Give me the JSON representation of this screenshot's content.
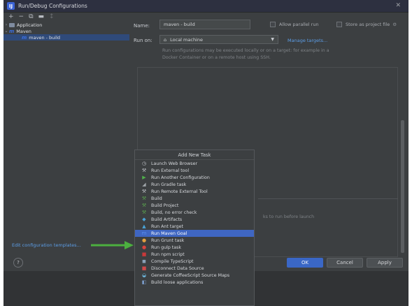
{
  "window": {
    "title": "Run/Debug Configurations",
    "close": "✕"
  },
  "toolbar": {
    "add": "+",
    "remove": "−",
    "copy": "⧉",
    "folder": "▬",
    "sort": "↕"
  },
  "tree": {
    "application": "Application",
    "maven": "Maven",
    "maven_build": "maven - build"
  },
  "form": {
    "name_label": "Name:",
    "name_value": "maven - build",
    "allow_parallel": "Allow parallel run",
    "store_as_project": "Store as project file",
    "run_on_label": "Run on:",
    "run_on_value": "Local machine",
    "manage_targets": "Manage targets...",
    "description": "Run configurations may be executed locally or on a target: for example in a Docker Container or on a remote host using SSH.",
    "before_launch_hint": "ks to run before launch"
  },
  "left": {
    "edit_templates": "Edit configuration templates...",
    "help": "?"
  },
  "buttons": {
    "ok": "OK",
    "cancel": "Cancel",
    "apply": "Apply"
  },
  "popup": {
    "header": "Add New Task",
    "items": [
      {
        "label": "Launch Web Browser",
        "icon": "globe-icon",
        "glyph": "◷",
        "color": "#bfc3c8"
      },
      {
        "label": "Run External tool",
        "icon": "wrench-icon",
        "glyph": "⚒",
        "color": "#bfc3c8"
      },
      {
        "label": "Run Another Configuration",
        "icon": "play-icon",
        "glyph": "▶",
        "color": "#4fb04a"
      },
      {
        "label": "Run Gradle task",
        "icon": "gradle-icon",
        "glyph": "◢",
        "color": "#9fa4a9"
      },
      {
        "label": "Run Remote External Tool",
        "icon": "wrench-icon",
        "glyph": "⚒",
        "color": "#bfc3c8"
      },
      {
        "label": "Build",
        "icon": "hammer-icon",
        "glyph": "⚒",
        "color": "#5aa24f"
      },
      {
        "label": "Build Project",
        "icon": "hammer-icon",
        "glyph": "⚒",
        "color": "#5aa24f"
      },
      {
        "label": "Build, no error check",
        "icon": "hammer-icon",
        "glyph": "⚒",
        "color": "#5aa24f"
      },
      {
        "label": "Build Artifacts",
        "icon": "artifact-icon",
        "glyph": "◆",
        "color": "#4aa3d8"
      },
      {
        "label": "Run Ant target",
        "icon": "ant-icon",
        "glyph": "▲",
        "color": "#4aa3d8"
      },
      {
        "label": "Run Maven Goal",
        "icon": "maven-icon",
        "glyph": "m",
        "color": "#5b8ff0"
      },
      {
        "label": "Run Grunt task",
        "icon": "grunt-icon",
        "glyph": "●",
        "color": "#e0a040"
      },
      {
        "label": "Run gulp task",
        "icon": "gulp-icon",
        "glyph": "●",
        "color": "#d9443f"
      },
      {
        "label": "Run npm script",
        "icon": "npm-icon",
        "glyph": "■",
        "color": "#c8393a"
      },
      {
        "label": "Compile TypeScript",
        "icon": "typescript-icon",
        "glyph": "◼",
        "color": "#8aa2b8"
      },
      {
        "label": "Disconnect Data Source",
        "icon": "disconnect-icon",
        "glyph": "■",
        "color": "#d04a4a"
      },
      {
        "label": "Generate CoffeeScript Source Maps",
        "icon": "coffeescript-icon",
        "glyph": "◒",
        "color": "#6cb3d8"
      },
      {
        "label": "Build loose applications",
        "icon": "build-loose-icon",
        "glyph": "◧",
        "color": "#7a9bc8"
      }
    ],
    "highlighted_index": 10
  },
  "colors": {
    "background": "#3c3f41",
    "accent": "#3a67c6",
    "link": "#5c9ee8",
    "arrow": "#4caf3f",
    "maven_icon": "#3b6fe0"
  }
}
